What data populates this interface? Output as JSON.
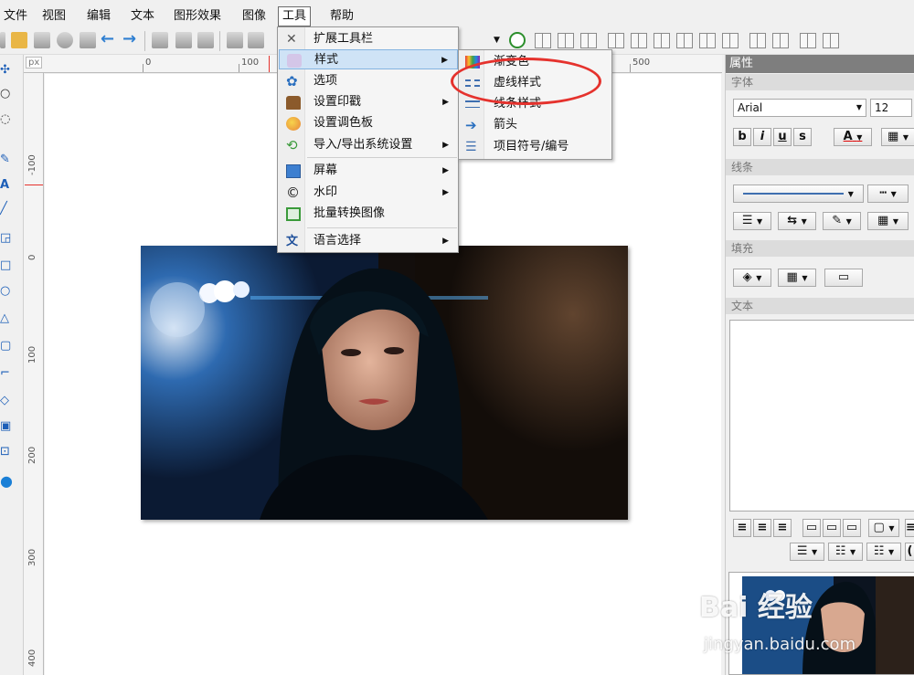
{
  "menubar": {
    "items": [
      "文件",
      "视图",
      "编辑",
      "文本",
      "图形效果",
      "图像",
      "工具",
      "帮助"
    ]
  },
  "tools_menu": {
    "items": [
      {
        "label": "扩展工具栏",
        "icon": "tools-icon",
        "has_submenu": false
      },
      {
        "label": "样式",
        "icon": "style-icon",
        "has_submenu": true
      },
      {
        "label": "选项",
        "icon": "gear-icon",
        "has_submenu": false
      },
      {
        "label": "设置印戳",
        "icon": "stamp-icon",
        "has_submenu": true
      },
      {
        "label": "设置调色板",
        "icon": "palette-icon",
        "has_submenu": false
      },
      {
        "label": "导入/导出系统设置",
        "icon": "import-export-icon",
        "has_submenu": true
      },
      {
        "label": "屏幕",
        "icon": "screen-icon",
        "has_submenu": true
      },
      {
        "label": "水印",
        "icon": "copyright-icon",
        "has_submenu": true
      },
      {
        "label": "批量转换图像",
        "icon": "batch-convert-icon",
        "has_submenu": false
      },
      {
        "label": "语言选择",
        "icon": "language-icon",
        "has_submenu": true
      }
    ]
  },
  "style_submenu": {
    "items": [
      {
        "label": "渐变色",
        "icon": "gradient-icon"
      },
      {
        "label": "虚线样式",
        "icon": "dashed-line-icon"
      },
      {
        "label": "线条样式",
        "icon": "line-style-icon"
      },
      {
        "label": "箭头",
        "icon": "arrow-icon"
      },
      {
        "label": "项目符号/编号",
        "icon": "bullet-list-icon"
      }
    ]
  },
  "ruler": {
    "unit": "px",
    "h_labels": [
      "0",
      "100",
      "500"
    ],
    "v_labels": [
      "-100",
      "0",
      "100",
      "200",
      "300",
      "400"
    ]
  },
  "properties": {
    "title": "属性",
    "font_section": "字体",
    "font_name": "Arial",
    "font_size": "12",
    "line_section": "线条",
    "fill_section": "填充",
    "text_section": "文本",
    "style_buttons": [
      "b",
      "i",
      "u",
      "s"
    ],
    "color_button": "A"
  },
  "watermark": {
    "brand": "Bai 经验",
    "url": "jingyan.baidu.com"
  },
  "colors": {
    "highlight": "#cfe3f6",
    "annotation": "#e5322d",
    "panel_header": "#7e7e7e"
  }
}
